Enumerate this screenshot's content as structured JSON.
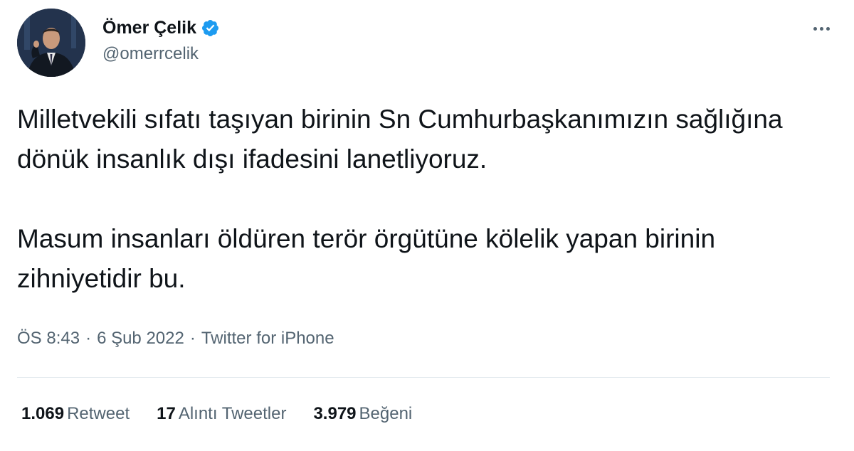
{
  "author": {
    "display_name": "Ömer Çelik",
    "handle": "@omerrcelik",
    "verified": true,
    "verified_icon": "verified-badge-icon",
    "verified_color": "#1d9bf0"
  },
  "menu": {
    "icon": "more-options-icon"
  },
  "tweet": {
    "paragraphs": [
      "Milletvekili sıfatı taşıyan birinin Sn Cumhurbaşkanımızın sağlığına dönük insanlık dışı ifadesini lanetliyoruz.",
      "Masum insanları öldüren terör örgütüne kölelik yapan birinin zihniyetidir bu."
    ]
  },
  "meta": {
    "time": "ÖS 8:43",
    "separator": "·",
    "date": "6 Şub 2022",
    "source": "Twitter for iPhone"
  },
  "stats": {
    "retweets": {
      "count": "1.069",
      "label": "Retweet"
    },
    "quotes": {
      "count": "17",
      "label": "Alıntı Tweetler"
    },
    "likes": {
      "count": "3.979",
      "label": "Beğeni"
    }
  },
  "colors": {
    "text_primary": "#0f1419",
    "text_secondary": "#536471",
    "divider": "#e1e8ed",
    "accent": "#1d9bf0"
  }
}
